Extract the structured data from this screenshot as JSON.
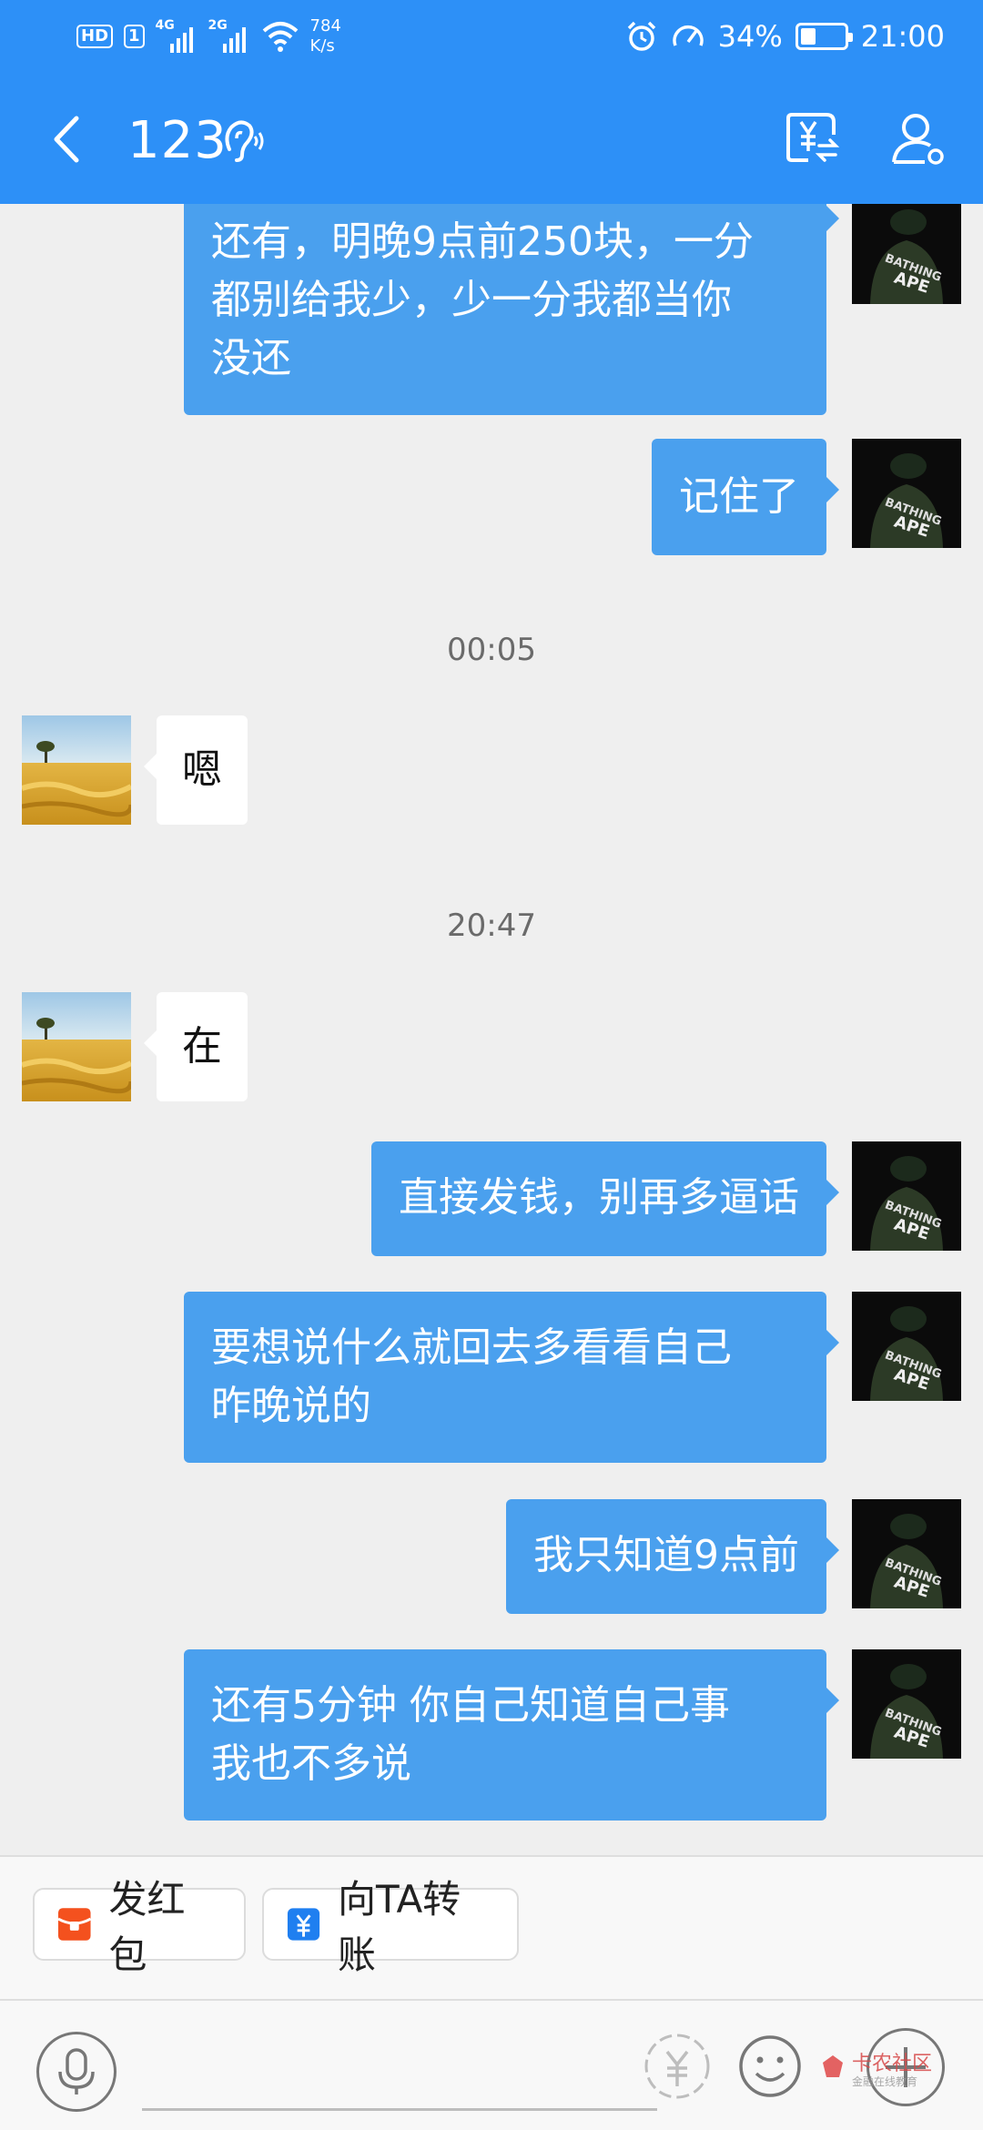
{
  "status_bar": {
    "hd_label": "HD",
    "sim1_label": "1",
    "net1_label": "4G",
    "net2_label": "2G",
    "speed_value": "784",
    "speed_unit": "K/s",
    "battery_percent": "34%",
    "battery_level": 0.34,
    "time": "21:00",
    "icons": [
      "alarm-icon",
      "speedometer-icon",
      "battery-icon",
      "wifi-icon"
    ]
  },
  "header": {
    "title": "123",
    "icons": [
      "back-arrow-icon",
      "ear-icon",
      "transfer-yuan-icon",
      "profile-settings-icon"
    ]
  },
  "messages": [
    {
      "type": "outgoing",
      "text": [
        "还有，明晚9点前250块，一分",
        "都别给我少，少一分我都当你",
        "没还"
      ]
    },
    {
      "type": "outgoing",
      "text": [
        "记住了"
      ]
    },
    {
      "type": "timestamp",
      "text": "00:05"
    },
    {
      "type": "incoming",
      "text": [
        "嗯"
      ]
    },
    {
      "type": "timestamp",
      "text": "20:47"
    },
    {
      "type": "incoming",
      "text": [
        "在"
      ]
    },
    {
      "type": "outgoing",
      "text": [
        "直接发钱，别再多逼话"
      ]
    },
    {
      "type": "outgoing",
      "text": [
        "要想说什么就回去多看看自己",
        "昨晚说的"
      ]
    },
    {
      "type": "outgoing",
      "text": [
        "我只知道9点前"
      ]
    },
    {
      "type": "outgoing",
      "text": [
        "还有5分钟 你自己知道自己事",
        "我也不多说"
      ]
    }
  ],
  "avatars": {
    "self_caption": "BATHING APE"
  },
  "quick_actions": [
    {
      "label": "发红包",
      "icon": "red-envelope-icon"
    },
    {
      "label": "向TA转账",
      "icon": "transfer-icon"
    }
  ],
  "input_bar": {
    "icons": [
      "microphone-icon",
      "red-packet-icon",
      "emoji-icon",
      "plus-icon"
    ],
    "watermark_text": "卡农社区",
    "watermark_sub": "金融在线教育"
  },
  "colors": {
    "header_bg": "#2d90f7",
    "outgoing_bubble": "#4aa0ee",
    "incoming_bubble": "#ffffff",
    "chat_bg": "#efefef"
  }
}
